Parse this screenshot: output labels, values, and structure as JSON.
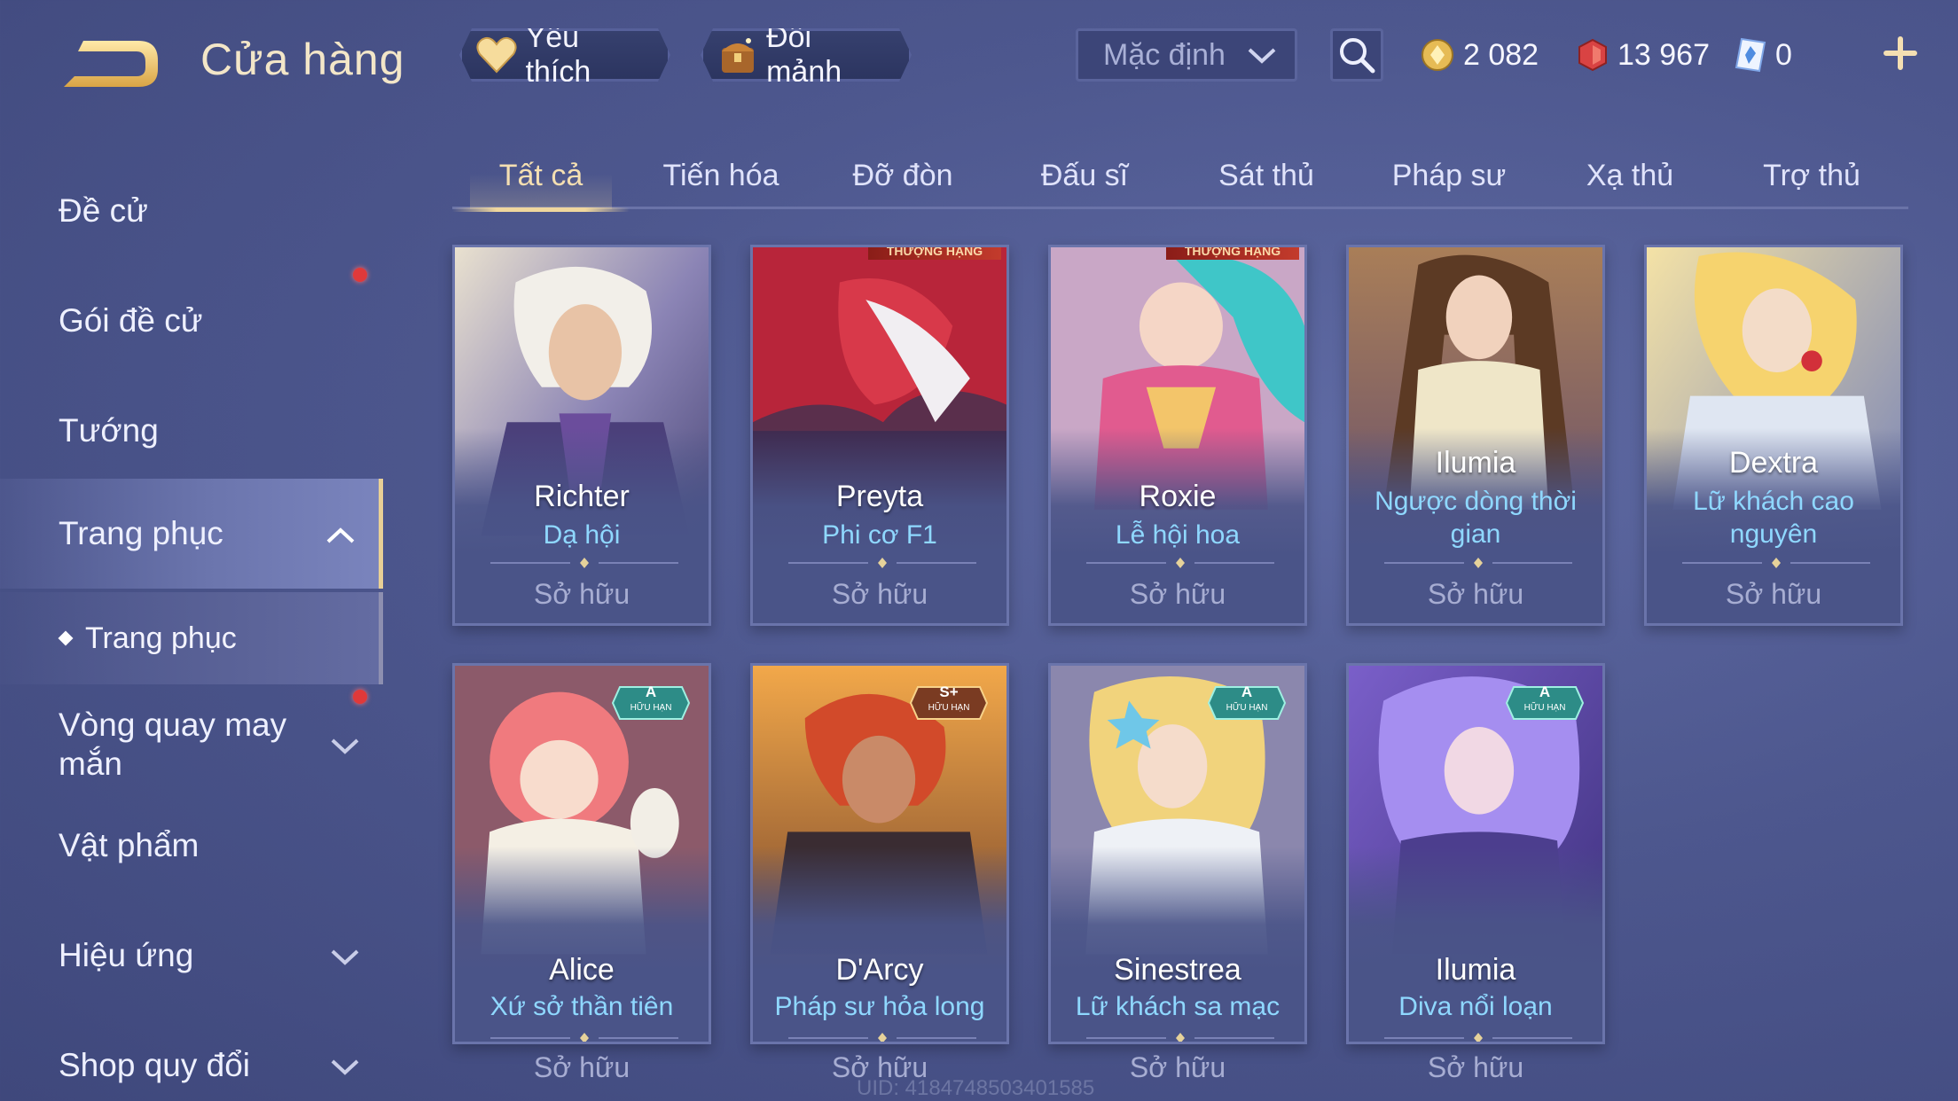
{
  "header": {
    "title": "Cửa hàng",
    "favorite_label": "Yêu thích",
    "exchange_label": "Đổi mảnh",
    "sort_value": "Mặc định"
  },
  "currencies": {
    "gold": "2 082",
    "voucher": "13 967",
    "diamond": "0"
  },
  "sidebar": {
    "items": [
      {
        "label": "Đề cử"
      },
      {
        "label": "Gói đề cử"
      },
      {
        "label": "Tướng"
      },
      {
        "label": "Trang phục"
      },
      {
        "label": "Vòng quay may mắn"
      },
      {
        "label": "Vật phẩm"
      },
      {
        "label": "Hiệu ứng"
      },
      {
        "label": "Shop quy đổi"
      }
    ],
    "sub_item": "Trang phục"
  },
  "tabs": [
    "Tất cả",
    "Tiến hóa",
    "Đỡ đòn",
    "Đấu sĩ",
    "Sát thủ",
    "Pháp sư",
    "Xạ thủ",
    "Trợ thủ"
  ],
  "cards": [
    {
      "hero": "Richter",
      "skin": "Dạ hội",
      "status": "Sở hữu"
    },
    {
      "hero": "Preyta",
      "skin": "Phi cơ F1",
      "status": "Sở hữu",
      "ribbon": "THƯỢNG HẠNG"
    },
    {
      "hero": "Roxie",
      "skin": "Lễ hội hoa",
      "status": "Sở hữu",
      "ribbon": "THƯỢNG HẠNG"
    },
    {
      "hero": "Ilumia",
      "skin": "Ngược dòng thời gian",
      "status": "Sở hữu"
    },
    {
      "hero": "Dextra",
      "skin": "Lữ khách cao nguyên",
      "status": "Sở hữu"
    },
    {
      "hero": "Alice",
      "skin": "Xứ sở thần tiên",
      "status": "Sở hữu",
      "badge_grade": "A",
      "badge_text": "HỮU HẠN"
    },
    {
      "hero": "D'Arcy",
      "skin": "Pháp sư hỏa long",
      "status": "Sở hữu",
      "badge_grade": "S+",
      "badge_text": "HỮU HẠN"
    },
    {
      "hero": "Sinestrea",
      "skin": "Lữ khách sa mạc",
      "status": "Sở hữu",
      "badge_grade": "A",
      "badge_text": "HỮU HẠN"
    },
    {
      "hero": "Ilumia",
      "skin": "Diva nổi loạn",
      "status": "Sở hữu",
      "badge_grade": "A",
      "badge_text": "HỮU HẠN"
    }
  ],
  "footer": {
    "uid": "UID: 4184748503401585"
  },
  "colors": {
    "background": "#4d578e",
    "accent_gold": "#f0d79d",
    "skin_name": "#8fd8ff",
    "notification": "#e0393a"
  }
}
